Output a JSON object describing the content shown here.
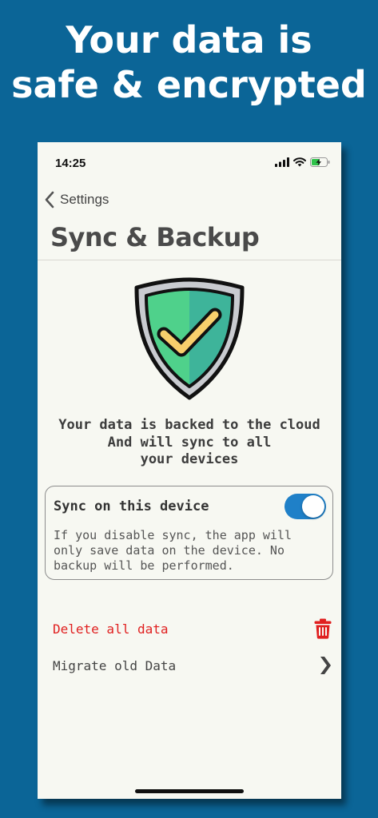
{
  "promo": {
    "headline_line1": "Your data is",
    "headline_line2": "safe & encrypted"
  },
  "status_bar": {
    "time": "14:25",
    "icons": [
      "signal-icon",
      "wifi-icon",
      "battery-charging-icon"
    ]
  },
  "navigation": {
    "back_label": "Settings",
    "back_icon": "chevron-left-icon"
  },
  "page": {
    "title": "Sync & Backup"
  },
  "hero": {
    "icon": "shield-check-icon",
    "info_line1": "Your data is backed to the cloud",
    "info_line2": "And will sync to all",
    "info_line3": "your devices"
  },
  "sync_card": {
    "title": "Sync on this device",
    "enabled": true,
    "desc_line1": "If you disable sync, the app will",
    "desc_line2": "only save data on the device. No",
    "desc_line3": "backup will be performed."
  },
  "actions": {
    "delete_label": "Delete all data",
    "delete_icon": "trash-icon",
    "migrate_label": "Migrate old Data",
    "migrate_icon": "chevron-right-icon"
  },
  "colors": {
    "background": "#0b6597",
    "screen": "#f7f8f2",
    "accent": "#1f80c8",
    "danger": "#e02020",
    "shield_green_light": "#4fd18b",
    "shield_green_dark": "#3eb49a",
    "check_yellow": "#f8cf6c"
  }
}
